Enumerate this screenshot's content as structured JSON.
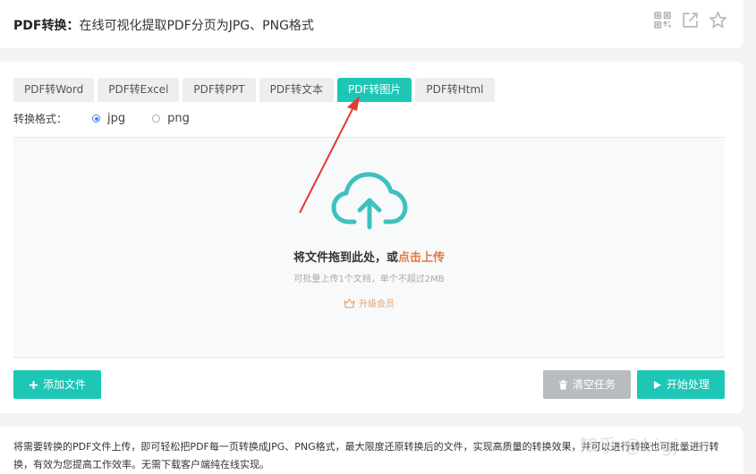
{
  "header": {
    "title_bold": "PDF转换：",
    "title_rest": "在线可视化提取PDF分页为JPG、PNG格式",
    "icons": [
      "qrcode-icon",
      "share-icon",
      "star-icon"
    ]
  },
  "tabs": [
    {
      "label": "PDF转Word",
      "active": false
    },
    {
      "label": "PDF转Excel",
      "active": false
    },
    {
      "label": "PDF转PPT",
      "active": false
    },
    {
      "label": "PDF转文本",
      "active": false
    },
    {
      "label": "PDF转图片",
      "active": true
    },
    {
      "label": "PDF转Html",
      "active": false
    }
  ],
  "format": {
    "label": "转换格式：",
    "options": [
      {
        "value": "jpg",
        "checked": true
      },
      {
        "value": "png",
        "checked": false
      }
    ]
  },
  "dropzone": {
    "main_text": "将文件拖到此处，或",
    "link_text": "点击上传",
    "sub_text": "可批量上传1个文档，单个不超过2MB",
    "upgrade_text": "升级会员"
  },
  "buttons": {
    "add": "添加文件",
    "clear": "清空任务",
    "start": "开始处理"
  },
  "footer": {
    "text": "将需要转换的PDF文件上传，即可轻松把PDF每一页转换成JPG、PNG格式，最大限度还原转换后的文件，实现高质量的转换效果，并可以进行转换也可批量进行转换，有效为您提高工作效率。无需下载客户端纯在线实现。"
  },
  "watermark": "知乎 @bigjon",
  "colors": {
    "accent": "#1ec6b6",
    "link": "#e6773a",
    "arrow": "#e03c31",
    "disabled": "#b9bcbf"
  }
}
